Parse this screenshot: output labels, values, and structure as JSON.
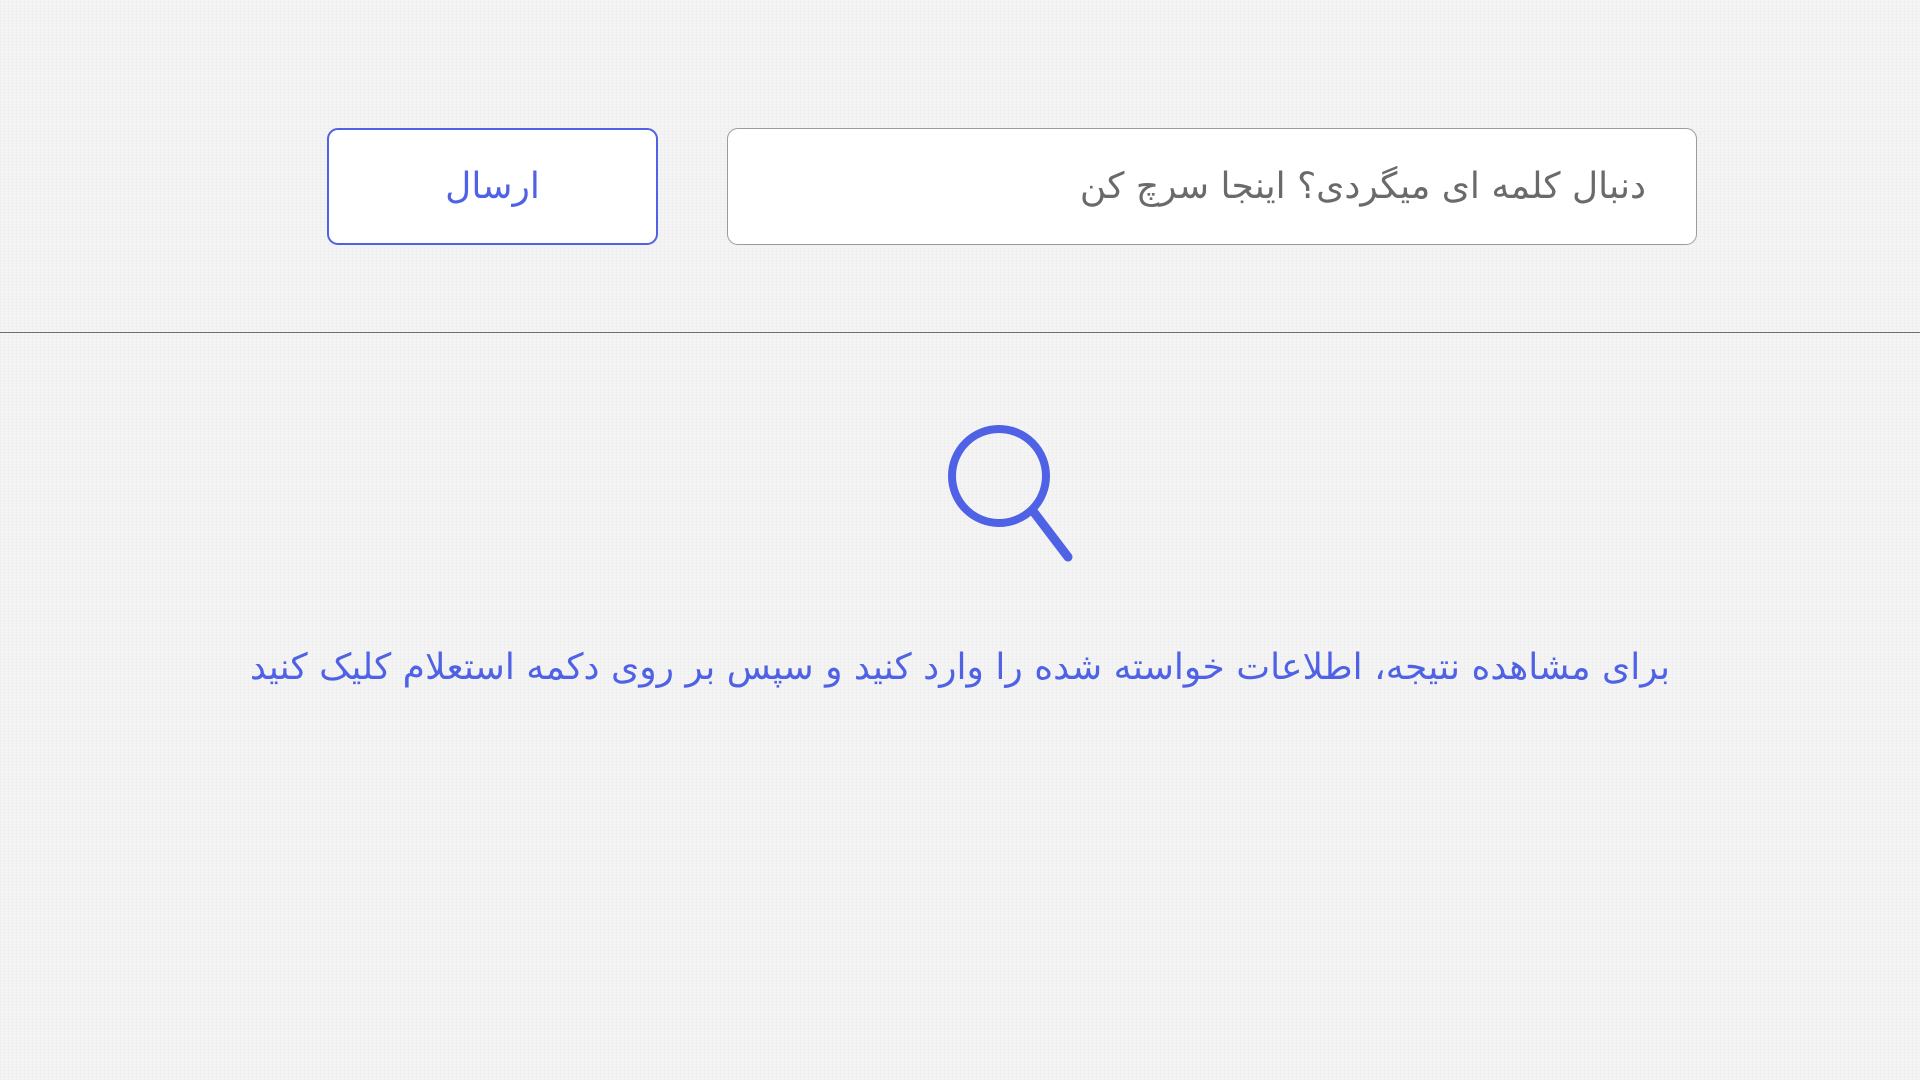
{
  "search": {
    "placeholder": "دنبال کلمه ای میگردی؟ اینجا سرچ کن",
    "value": ""
  },
  "submit_button": {
    "label": "ارسال"
  },
  "empty_state": {
    "icon": "search-icon",
    "message": "برای مشاهده نتیجه، اطلاعات خواسته شده را وارد کنید و سپس بر روی دکمه استعلام کلیک کنید"
  },
  "colors": {
    "accent": "#4f62e6",
    "background": "#f4f4f4",
    "field_border": "#9b9b9b",
    "placeholder_text": "#6a6a6a"
  }
}
